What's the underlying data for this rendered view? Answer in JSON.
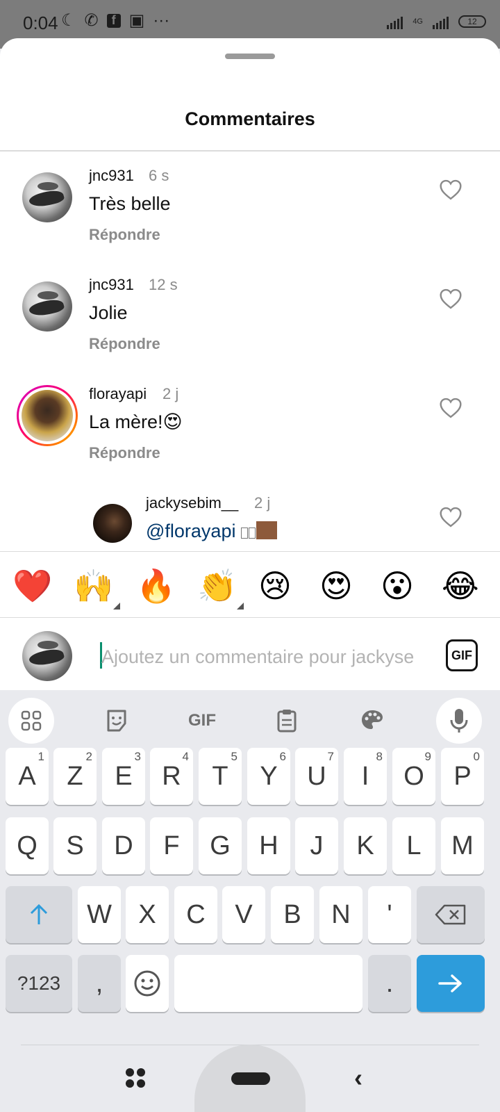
{
  "status_bar": {
    "time": "0:04",
    "network": "4G",
    "battery": "12"
  },
  "sheet": {
    "title": "Commentaires"
  },
  "comments": [
    {
      "username": "jnc931",
      "time": "6 s",
      "text": "Très belle",
      "reply": "Répondre"
    },
    {
      "username": "jnc931",
      "time": "12 s",
      "text": "Jolie",
      "reply": "Répondre"
    },
    {
      "username": "florayapi",
      "time": "2 j",
      "text": "La mère!😍",
      "reply": "Répondre"
    },
    {
      "username": "jackysebim__",
      "time": "2 j",
      "mention": "@florayapi"
    }
  ],
  "emoji_bar": [
    "❤️",
    "🙌",
    "🔥",
    "👏",
    "😢",
    "😍",
    "😮",
    "😂"
  ],
  "composer": {
    "placeholder": "Ajoutez un commentaire pour jackyse",
    "gif_label": "GIF"
  },
  "keyboard": {
    "toolbar": {
      "gif_label": "GIF"
    },
    "row1": [
      {
        "key": "A",
        "sup": "1"
      },
      {
        "key": "Z",
        "sup": "2"
      },
      {
        "key": "E",
        "sup": "3"
      },
      {
        "key": "R",
        "sup": "4"
      },
      {
        "key": "T",
        "sup": "5"
      },
      {
        "key": "Y",
        "sup": "6"
      },
      {
        "key": "U",
        "sup": "7"
      },
      {
        "key": "I",
        "sup": "8"
      },
      {
        "key": "O",
        "sup": "9"
      },
      {
        "key": "P",
        "sup": "0"
      }
    ],
    "row2": [
      "Q",
      "S",
      "D",
      "F",
      "G",
      "H",
      "J",
      "K",
      "L",
      "M"
    ],
    "row3": [
      "W",
      "X",
      "C",
      "V",
      "B",
      "N",
      "'"
    ],
    "row4": {
      "numbers": "?123",
      "comma": ",",
      "period": "."
    }
  },
  "colors": {
    "accent": "#2d9cdb",
    "mention": "#00376b",
    "secondary_text": "#8a8a8a"
  }
}
